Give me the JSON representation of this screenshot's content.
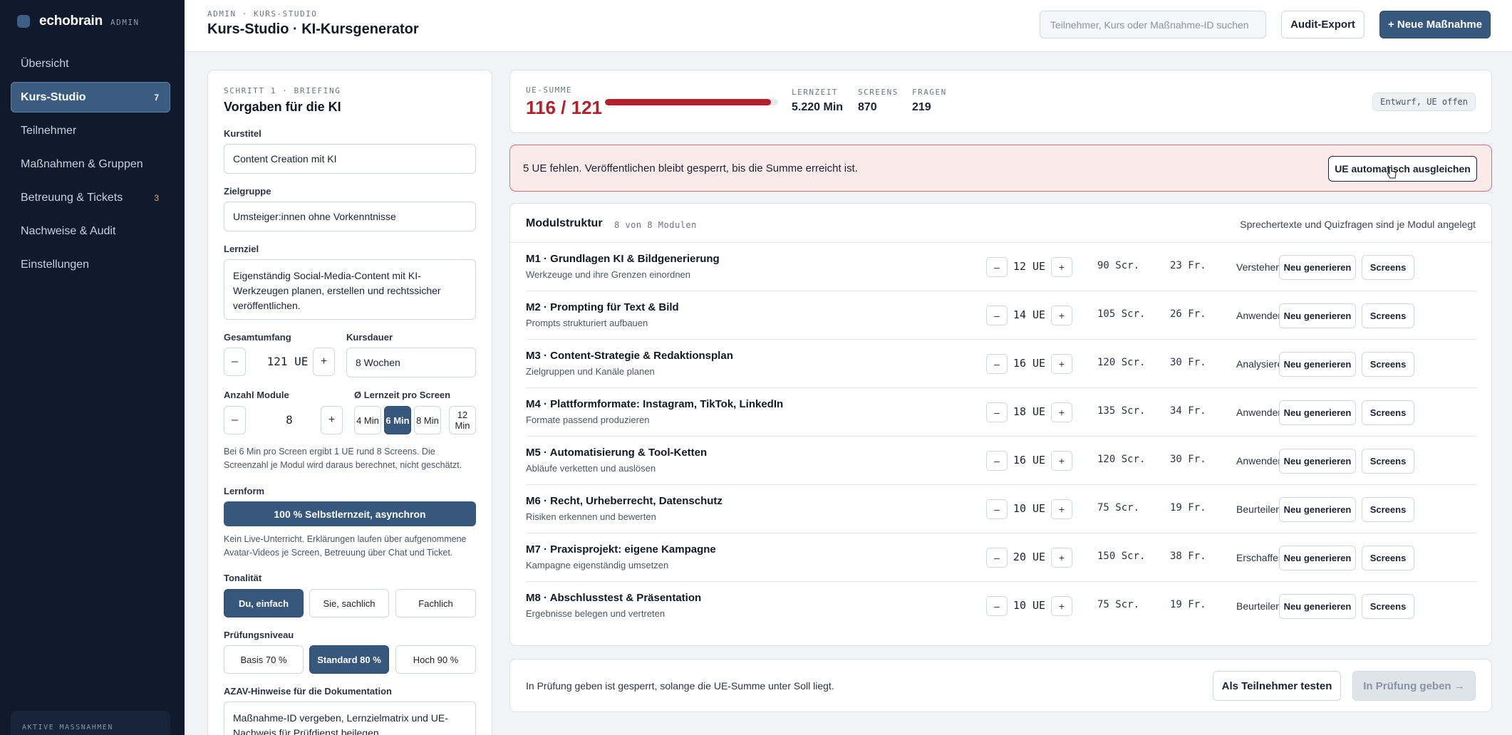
{
  "brand": {
    "name": "echobrain",
    "tag": "ADMIN"
  },
  "sidebar": {
    "items": [
      {
        "label": "Übersicht",
        "badge": ""
      },
      {
        "label": "Kurs-Studio",
        "badge": "7"
      },
      {
        "label": "Teilnehmer",
        "badge": ""
      },
      {
        "label": "Maßnahmen & Gruppen",
        "badge": ""
      },
      {
        "label": "Betreuung & Tickets",
        "badge": "3"
      },
      {
        "label": "Nachweise & Audit",
        "badge": ""
      },
      {
        "label": "Einstellungen",
        "badge": ""
      }
    ],
    "footer_label": "AKTIVE MASSNAHMEN"
  },
  "header": {
    "kicker": "ADMIN · KURS-STUDIO",
    "title": "Kurs-Studio · KI-Kursgenerator",
    "search_placeholder": "Teilnehmer, Kurs oder Maßnahme-ID suchen",
    "audit_label": "Audit-Export",
    "new_label": "+ Neue Maßnahme"
  },
  "briefing": {
    "step": "SCHRITT 1 · BRIEFING",
    "title": "Vorgaben für die KI",
    "kurstitel_label": "Kurstitel",
    "kurstitel_value": "Content Creation mit KI",
    "zielgruppe_label": "Zielgruppe",
    "zielgruppe_value": "Umsteiger:innen ohne Vorkenntnisse",
    "lernziel_label": "Lernziel",
    "lernziel_value": "Eigenständig Social-Media-Content mit KI-Werkzeugen planen, erstellen und rechtssicher veröffentlichen.",
    "umfang_label": "Gesamtumfang",
    "umfang_value": "121 UE",
    "dauer_label": "Kursdauer",
    "dauer_value": "8 Wochen",
    "module_label": "Anzahl Module",
    "module_value": "8",
    "lernzeit_label": "Ø Lernzeit pro Screen",
    "lernzeit_options": [
      "4 Min",
      "6 Min",
      "8 Min",
      "12 Min"
    ],
    "lernzeit_hint": "Bei 6 Min pro Screen ergibt 1 UE rund 8 Screens. Die Screenzahl je Modul wird daraus berechnet, nicht geschätzt.",
    "lernform_label": "Lernform",
    "lernform_value": "100 % Selbstlernzeit, asynchron",
    "lernform_hint": "Kein Live-Unterricht. Erklärungen laufen über aufgenommene Avatar-Videos je Screen, Betreuung über Chat und Ticket.",
    "tonalitaet_label": "Tonalität",
    "tonalitaet_options": [
      "Du, einfach",
      "Sie, sachlich",
      "Fachlich"
    ],
    "pruefung_label": "Prüfungsniveau",
    "pruefung_options": [
      "Basis 70 %",
      "Standard 80 %",
      "Hoch 90 %"
    ],
    "azav_label": "AZAV-Hinweise für die Dokumentation",
    "azav_value": "Maßnahme-ID vergeben, Lernzielmatrix und UE-Nachweis für Prüfdienst beilegen."
  },
  "stats": {
    "ue_label": "UE-SUMME",
    "ue_value": "116 / 121",
    "ue_progress": 0.959,
    "lernzeit_label": "LERNZEIT",
    "lernzeit_value": "5.220 Min",
    "screens_label": "SCREENS",
    "screens_value": "870",
    "fragen_label": "FRAGEN",
    "fragen_value": "219",
    "status": "Entwurf, UE offen"
  },
  "alert": {
    "text": "5 UE fehlen. Veröffentlichen bleibt gesperrt, bis die Summe erreicht ist.",
    "button": "UE automatisch ausgleichen"
  },
  "modules": {
    "title": "Modulstruktur",
    "count": "8 von 8 Modulen",
    "note": "Sprechertexte und Quizfragen sind je Modul angelegt",
    "regen_label": "Neu generieren",
    "screens_label": "Screens",
    "rows": [
      {
        "name": "M1 · Grundlagen KI & Bildgenerierung",
        "sub": "Werkzeuge und ihre Grenzen einordnen",
        "ue": "12 UE",
        "scr": "90 Scr.",
        "fr": "23 Fr.",
        "level": "Verstehen"
      },
      {
        "name": "M2 · Prompting für Text & Bild",
        "sub": "Prompts strukturiert aufbauen",
        "ue": "14 UE",
        "scr": "105 Scr.",
        "fr": "26 Fr.",
        "level": "Anwenden"
      },
      {
        "name": "M3 · Content-Strategie & Redaktionsplan",
        "sub": "Zielgruppen und Kanäle planen",
        "ue": "16 UE",
        "scr": "120 Scr.",
        "fr": "30 Fr.",
        "level": "Analysieren"
      },
      {
        "name": "M4 · Plattformformate: Instagram, TikTok, LinkedIn",
        "sub": "Formate passend produzieren",
        "ue": "18 UE",
        "scr": "135 Scr.",
        "fr": "34 Fr.",
        "level": "Anwenden"
      },
      {
        "name": "M5 · Automatisierung & Tool-Ketten",
        "sub": "Abläufe verketten und auslösen",
        "ue": "16 UE",
        "scr": "120 Scr.",
        "fr": "30 Fr.",
        "level": "Anwenden"
      },
      {
        "name": "M6 · Recht, Urheberrecht, Datenschutz",
        "sub": "Risiken erkennen und bewerten",
        "ue": "10 UE",
        "scr": "75 Scr.",
        "fr": "19 Fr.",
        "level": "Beurteilen"
      },
      {
        "name": "M7 · Praxisprojekt: eigene Kampagne",
        "sub": "Kampagne eigenständig umsetzen",
        "ue": "20 UE",
        "scr": "150 Scr.",
        "fr": "38 Fr.",
        "level": "Erschaffen"
      },
      {
        "name": "M8 · Abschlusstest & Präsentation",
        "sub": "Ergebnisse belegen und vertreten",
        "ue": "10 UE",
        "scr": "75 Scr.",
        "fr": "19 Fr.",
        "level": "Beurteilen"
      }
    ]
  },
  "footer": {
    "text": "In Prüfung geben ist gesperrt, solange die UE-Summe unter Soll liegt.",
    "test_label": "Als Teilnehmer testen",
    "submit_label": "In Prüfung geben →"
  }
}
